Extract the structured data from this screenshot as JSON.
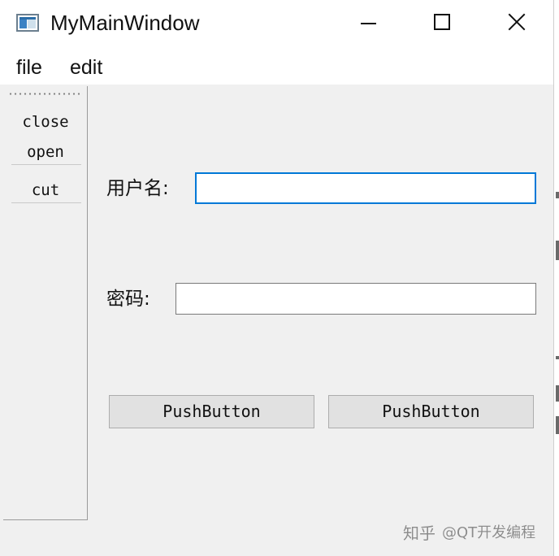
{
  "window": {
    "title": "MyMainWindow"
  },
  "menu": {
    "items": [
      {
        "label": "file"
      },
      {
        "label": "edit"
      }
    ]
  },
  "toolbar": {
    "actions": [
      {
        "label": "close"
      },
      {
        "label": "open"
      },
      {
        "label": "cut"
      }
    ]
  },
  "form": {
    "username_label": "用户名:",
    "username_value": "",
    "username_placeholder": "",
    "password_label": "密码:",
    "password_value": "",
    "password_placeholder": ""
  },
  "buttons": [
    {
      "label": "PushButton"
    },
    {
      "label": "PushButton"
    }
  ],
  "watermark": {
    "site": "知乎",
    "account": "@QT开发编程"
  },
  "colors": {
    "focus_border": "#0078d7",
    "window_background": "#f0f0f0",
    "button_background": "#e1e1e1",
    "watermark_text": "#8c8c8c"
  },
  "icons": {
    "app": "window-app-icon",
    "minimize": "minimize-icon",
    "maximize": "maximize-icon",
    "close": "close-icon"
  }
}
